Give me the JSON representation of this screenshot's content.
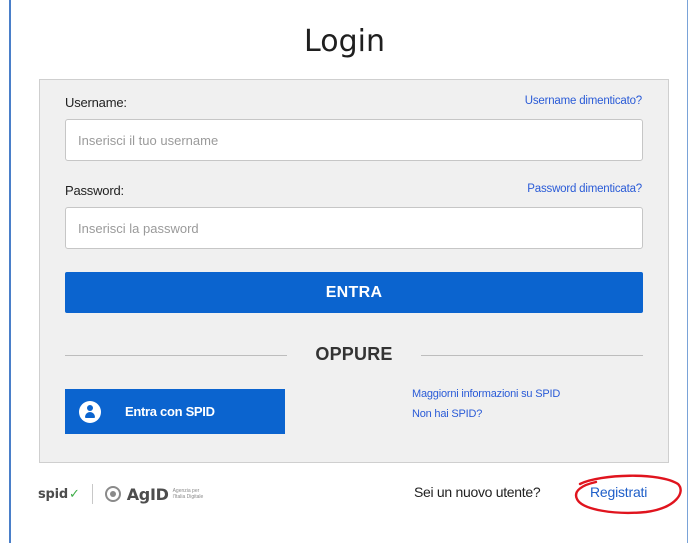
{
  "page": {
    "title": "Login"
  },
  "form": {
    "username_label": "Username:",
    "username_forgot": "Username dimenticato?",
    "username_placeholder": "Inserisci il tuo username",
    "password_label": "Password:",
    "password_forgot": "Password dimenticata?",
    "password_placeholder": "Inserisci la password",
    "submit_label": "ENTRA",
    "separator": "OPPURE"
  },
  "spid": {
    "button_label": "Entra con SPID",
    "info_link": "Maggiorni informazioni su SPID",
    "no_spid_link": "Non hai SPID?"
  },
  "footer": {
    "spid_logo": "spid",
    "agid_logo": "AgID",
    "agid_subtitle": "Agenzia per l'Italia Digitale",
    "new_user_text": "Sei un nuovo utente?",
    "register_link": "Registrati"
  },
  "colors": {
    "primary": "#0b64cf",
    "link": "#2a5bd7",
    "card_bg": "#f0f0f0",
    "annotation": "#e0141e"
  }
}
